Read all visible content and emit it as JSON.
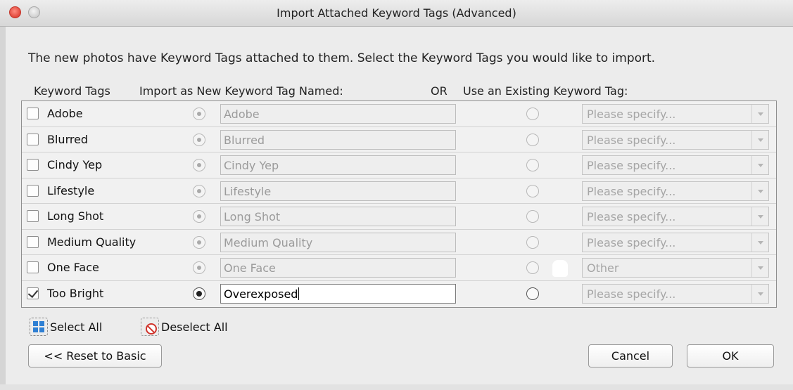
{
  "window": {
    "title": "Import Attached Keyword Tags (Advanced)"
  },
  "intro": "The new photos have Keyword Tags attached to them.  Select the Keyword Tags you would like to import.",
  "headers": {
    "keyword_tags": "Keyword Tags",
    "import_as_new": "Import as New Keyword Tag Named:",
    "or": "OR",
    "use_existing": "Use an Existing Keyword Tag:"
  },
  "rows": [
    {
      "tag": "Adobe",
      "checked": false,
      "new_name": "Adobe",
      "existing": "Please specify...",
      "mode": "new"
    },
    {
      "tag": "Blurred",
      "checked": false,
      "new_name": "Blurred",
      "existing": "Please specify...",
      "mode": "new"
    },
    {
      "tag": "Cindy Yep",
      "checked": false,
      "new_name": "Cindy Yep",
      "existing": "Please specify...",
      "mode": "new"
    },
    {
      "tag": "Lifestyle",
      "checked": false,
      "new_name": "Lifestyle",
      "existing": "Please specify...",
      "mode": "new"
    },
    {
      "tag": "Long Shot",
      "checked": false,
      "new_name": "Long Shot",
      "existing": "Please specify...",
      "mode": "new"
    },
    {
      "tag": "Medium Quality",
      "checked": false,
      "new_name": "Medium Quality",
      "existing": "Please specify...",
      "mode": "new"
    },
    {
      "tag": "One Face",
      "checked": false,
      "new_name": "One Face",
      "existing": "Other",
      "mode": "new"
    },
    {
      "tag": "Too Bright",
      "checked": true,
      "new_name": "Overexposed",
      "existing": "Please specify...",
      "mode": "new"
    }
  ],
  "links": {
    "select_all": "Select All",
    "deselect_all": "Deselect All"
  },
  "buttons": {
    "reset": "<< Reset to Basic",
    "cancel": "Cancel",
    "ok": "OK"
  },
  "icons": {
    "select_all": "grid-select-icon",
    "deselect_all": "no-entry-icon",
    "checkmark": "checkmark-icon"
  },
  "colors": {
    "window_bg": "#ececec",
    "accent": "#2e7fd3",
    "deselect_red": "#d0342c"
  }
}
